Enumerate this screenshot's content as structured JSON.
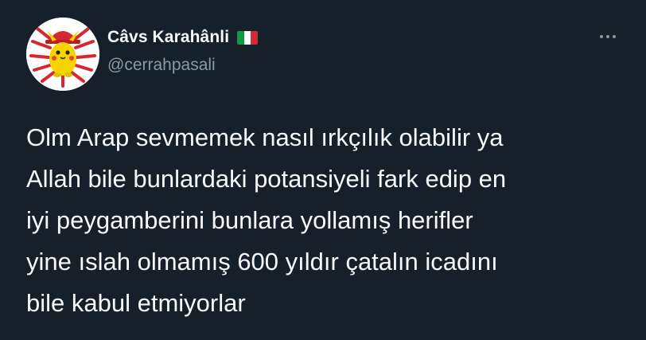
{
  "author": {
    "display_name": "Câvs Karahânli",
    "handle": "@cerrahpasali",
    "flag_emoji": "italy-flag",
    "avatar_icon": "pikachu-hat-avatar"
  },
  "tweet": {
    "lines": [
      "Olm Arap sevmemek nasıl ırkçılık olabilir ya",
      "Allah bile bunlardaki potansiyeli fark edip en",
      "iyi peygamberini bunlara yollamış herifler",
      "yine ıslah olmamış 600 yıldır çatalın icadını",
      "bile kabul etmiyorlar"
    ]
  },
  "actions": {
    "more_icon": "more-options-icon"
  },
  "colors": {
    "background": "#15202b",
    "text": "#f7f9f9",
    "secondary_text": "#8b98a5",
    "avatar_red": "#d8262e",
    "avatar_yellow": "#f5d400"
  }
}
